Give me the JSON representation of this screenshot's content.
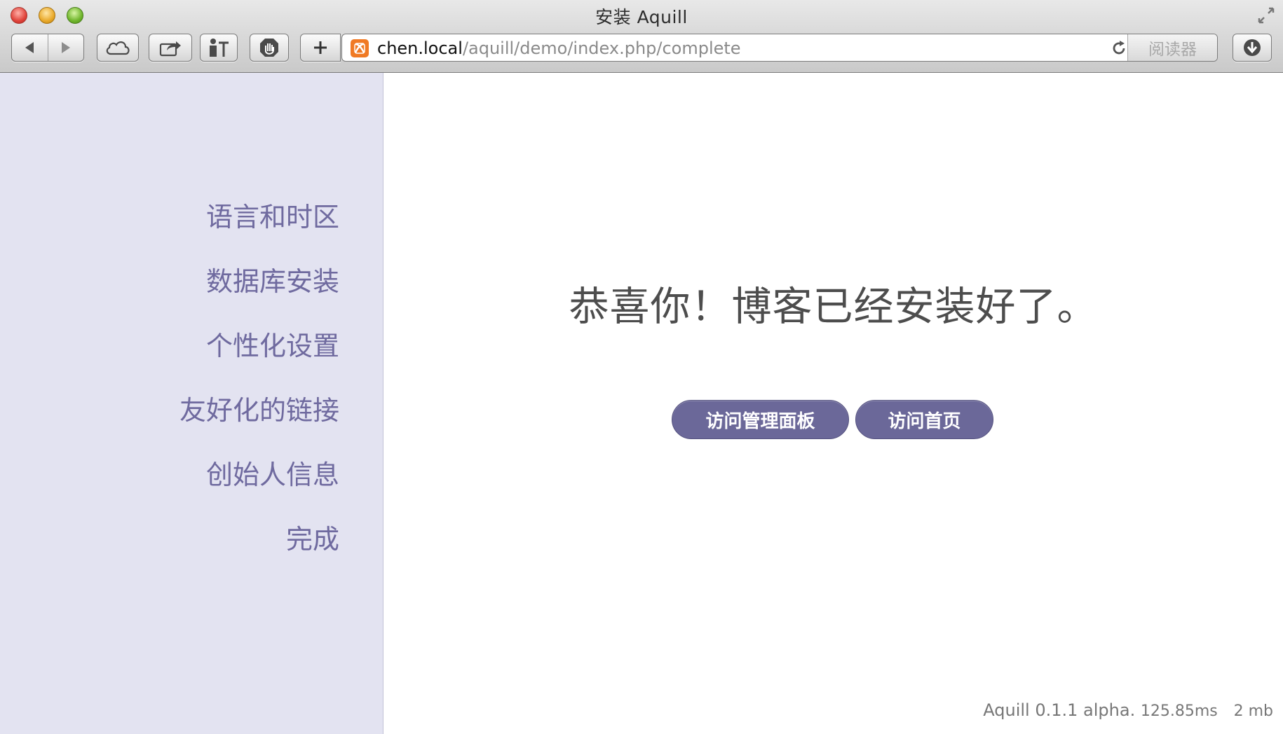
{
  "window": {
    "title": "安装 Aquill"
  },
  "toolbar": {
    "url_host": "chen.local",
    "url_path": "/aquill/demo/index.php/complete",
    "reader_label": "阅读器"
  },
  "sidebar": {
    "steps": [
      {
        "label": "语言和时区"
      },
      {
        "label": "数据库安装"
      },
      {
        "label": "个性化设置"
      },
      {
        "label": "友好化的链接"
      },
      {
        "label": "创始人信息"
      },
      {
        "label": "完成"
      }
    ]
  },
  "main": {
    "headline": "恭喜你！博客已经安装好了。",
    "admin_button": "访问管理面板",
    "home_button": "访问首页"
  },
  "footer": {
    "version": "Aquill 0.1.1 alpha.",
    "time": "125.85ms",
    "memory": "2 mb"
  },
  "colors": {
    "sidebar_bg": "#e3e3f1",
    "accent": "#6b6899",
    "step_text": "#6f6a9f"
  },
  "icons": [
    "back-icon",
    "forward-icon",
    "icloud-icon",
    "share-icon",
    "bookmarks-icon",
    "adblock-icon",
    "new-tab-icon",
    "xampp-favicon-icon",
    "reload-icon",
    "downloads-icon",
    "fullscreen-icon"
  ]
}
